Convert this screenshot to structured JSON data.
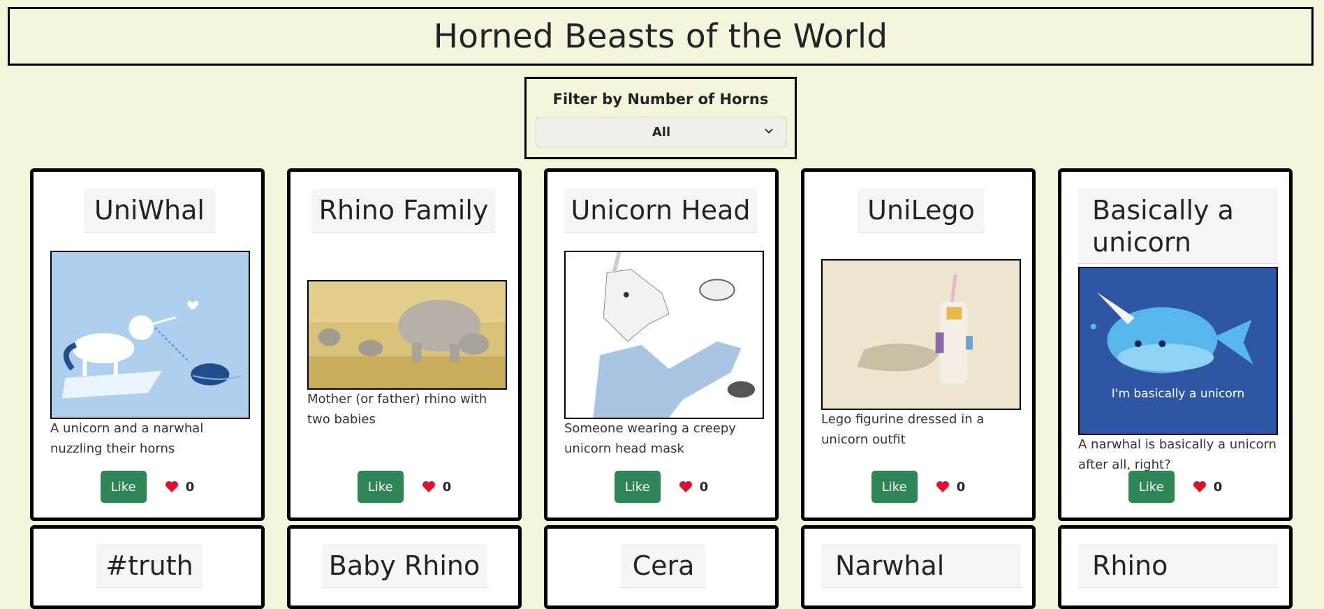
{
  "page": {
    "title": "Horned Beasts of the World"
  },
  "filter": {
    "label": "Filter by Number of Horns",
    "selected": "All"
  },
  "like_button_label": "Like",
  "cards": [
    {
      "title": "UniWhal",
      "description": "A unicorn and a narwhal nuzzling their horns",
      "likes": "0"
    },
    {
      "title": "Rhino Family",
      "description": "Mother (or father) rhino with two babies",
      "likes": "0"
    },
    {
      "title": "Unicorn Head",
      "description": "Someone wearing a creepy unicorn head mask",
      "likes": "0"
    },
    {
      "title": "UniLego",
      "description": "Lego figurine dressed in a unicorn outfit",
      "likes": "0"
    },
    {
      "title": "Basically a unicorn",
      "description": "A narwhal is basically a unicorn after all, right?",
      "likes": "0",
      "image_caption": "I'm basically a unicorn"
    },
    {
      "title": "#truth"
    },
    {
      "title": "Baby Rhino"
    },
    {
      "title": "Cera"
    },
    {
      "title": "Narwhal"
    },
    {
      "title": "Rhino"
    }
  ],
  "colors": {
    "background": "#f5f5dc",
    "like_button": "#2e8555",
    "heart": "#e0112b"
  }
}
